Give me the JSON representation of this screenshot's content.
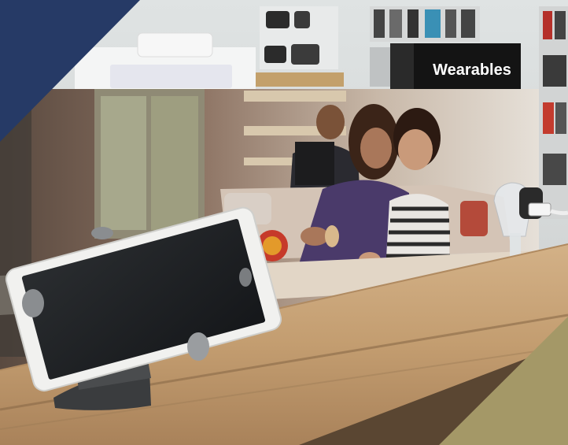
{
  "scene": {
    "sign": {
      "text": "Wearables"
    },
    "colors": {
      "corner_navy": "#263a66",
      "corner_gold": "#a49867",
      "wood_top": "#c9a57a",
      "wood_edge": "#8a6a48",
      "tablet_frame": "#f1f1ef",
      "tablet_screen": "#1f2224",
      "sign_bg": "#141414"
    }
  }
}
